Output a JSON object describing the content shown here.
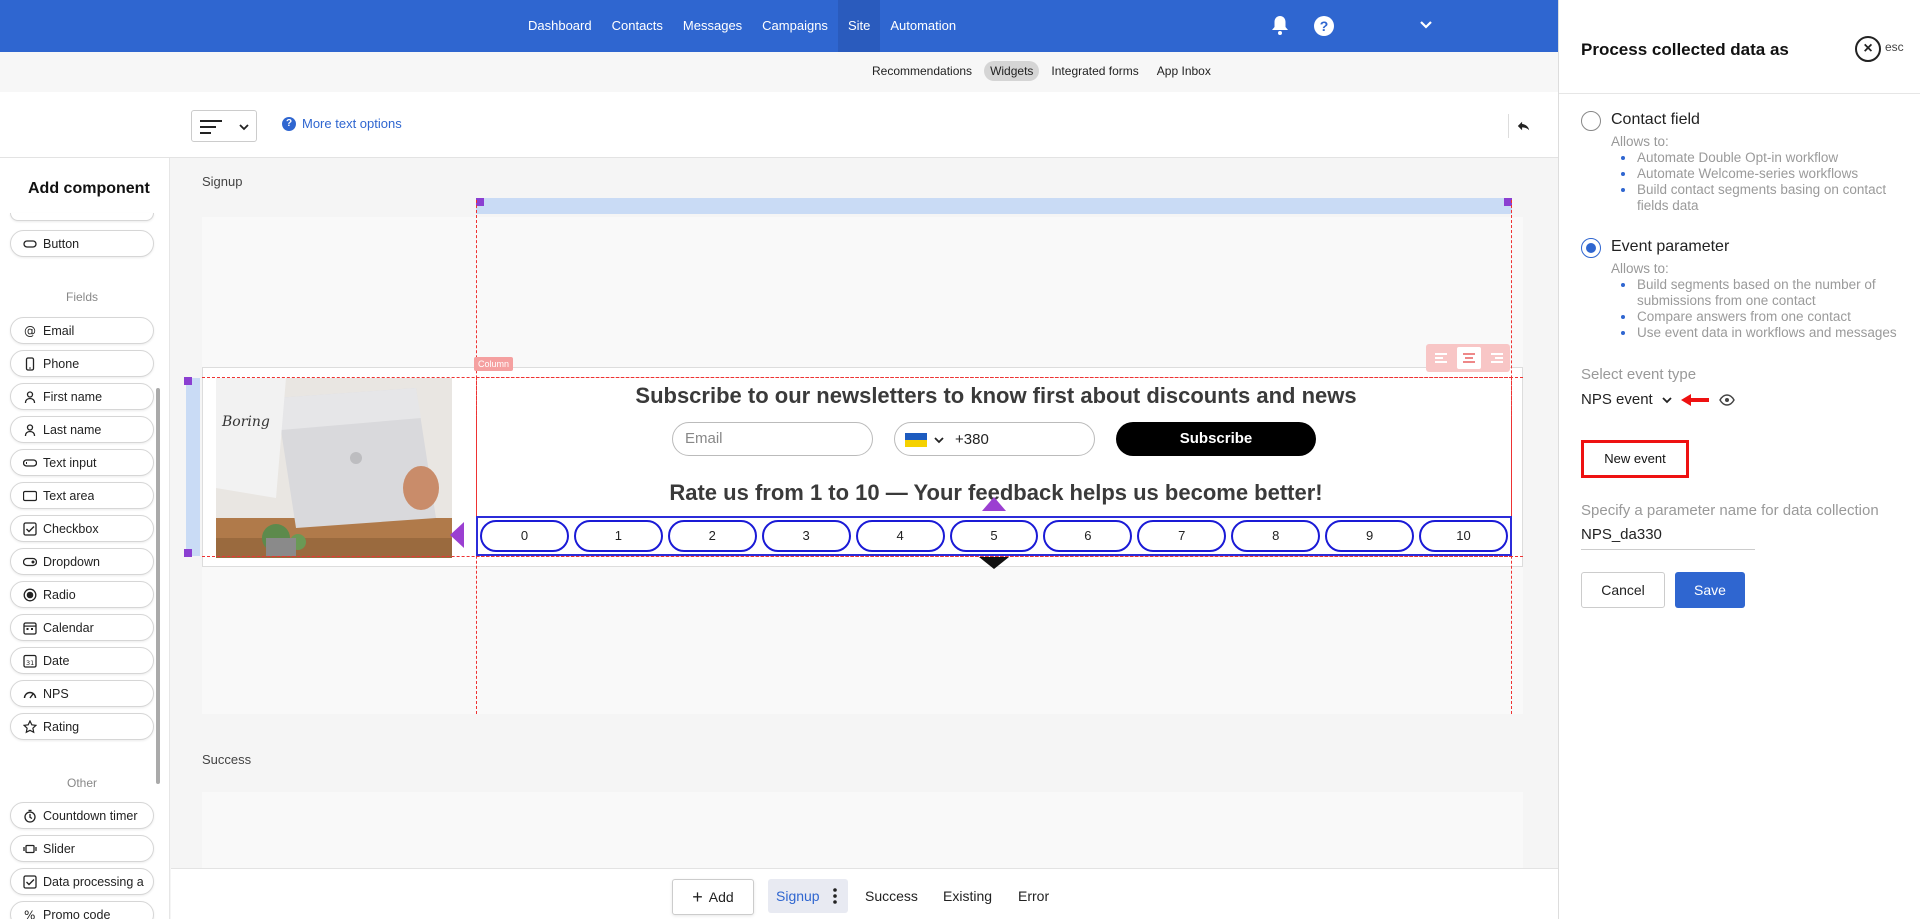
{
  "nav": {
    "items": [
      "Dashboard",
      "Contacts",
      "Messages",
      "Campaigns",
      "Site",
      "Automation"
    ],
    "active": "Site",
    "help": "?"
  },
  "subnav": {
    "items": [
      "Recommendations",
      "Widgets",
      "Integrated forms",
      "App Inbox"
    ],
    "active": "Widgets"
  },
  "toolbar": {
    "more_text": "More text options"
  },
  "sidebar": {
    "title": "Add component",
    "button": "Button",
    "fields_label": "Fields",
    "fields": [
      "Email",
      "Phone",
      "First name",
      "Last name",
      "Text input",
      "Text area",
      "Checkbox",
      "Dropdown",
      "Radio",
      "Calendar",
      "Date",
      "NPS",
      "Rating"
    ],
    "other_label": "Other",
    "other": [
      "Countdown timer",
      "Slider",
      "Data processing a",
      "Promo code"
    ]
  },
  "canvas": {
    "signup_label": "Signup",
    "success_label": "Success",
    "column_tag": "Column",
    "headline": "Subscribe to our newsletters to know first about discounts and news",
    "email_placeholder": "Email",
    "phone_code": "+380",
    "subscribe_label": "Subscribe",
    "rate_text": "Rate us from 1 to 10 — Your feedback helps us become better!",
    "nps_values": [
      "0",
      "1",
      "2",
      "3",
      "4",
      "5",
      "6",
      "7",
      "8",
      "9",
      "10"
    ]
  },
  "bottombar": {
    "add_label": "Add",
    "tabs": [
      "Signup",
      "Success",
      "Existing",
      "Error"
    ],
    "active": "Signup"
  },
  "panel": {
    "title": "Process collected data as",
    "esc": "esc",
    "contact_field": {
      "label": "Contact field",
      "allows": "Allows to:",
      "items": [
        "Automate Double Opt-in workflow",
        "Automate Welcome-series workflows",
        "Build contact segments basing on contact fields data"
      ],
      "selected": false
    },
    "event_parameter": {
      "label": "Event parameter",
      "allows": "Allows to:",
      "items": [
        "Build segments based on the number of submissions from one contact",
        "Compare answers from one contact",
        "Use event data in workflows and messages"
      ],
      "selected": true
    },
    "select_event_label": "Select event type",
    "event_value": "NPS event",
    "new_event_label": "New event",
    "param_label": "Specify a parameter name for data collection",
    "param_value": "NPS_da330",
    "cancel_label": "Cancel",
    "save_label": "Save"
  },
  "colors": {
    "primary": "#2f66d0",
    "highlight": "#e11111",
    "nps_border": "#1a1ad6"
  }
}
